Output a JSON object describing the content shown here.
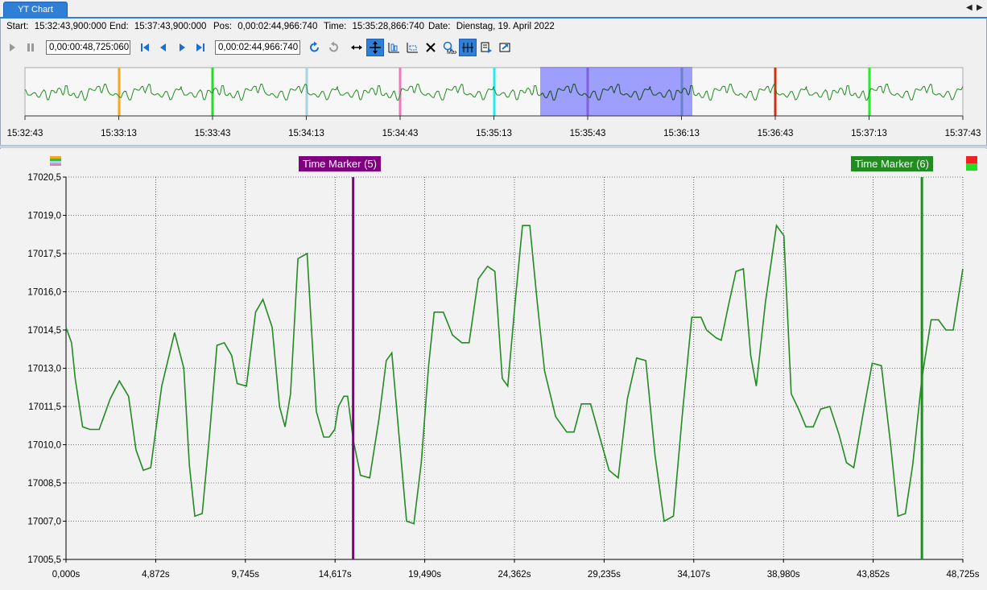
{
  "tab": {
    "title": "YT Chart"
  },
  "info": {
    "start_label": "Start:",
    "start_value": "15:32:43,900:000",
    "end_label": "End:",
    "end_value": "15:37:43,900:000",
    "pos_label": "Pos:",
    "pos_value": "0,00:02:44,966:740",
    "time_label": "Time:",
    "time_value": "15:35:28,866:740",
    "date_label": "Date:",
    "date_value": "Dienstag, 19. April 2022"
  },
  "toolbar": {
    "span_value": "0,00:00:48,725:060",
    "position_value": "0,00:02:44,966:740"
  },
  "overview": {
    "ticks": [
      "15:32:43",
      "15:33:13",
      "15:33:43",
      "15:34:13",
      "15:34:43",
      "15:35:13",
      "15:35:43",
      "15:36:13",
      "15:36:43",
      "15:37:13",
      "15:37:43"
    ],
    "markers": [
      {
        "color": "#f5a623"
      },
      {
        "color": "#22dd22"
      },
      {
        "color": "#a9d2e8"
      },
      {
        "color": "#ee77bb"
      },
      {
        "color": "#22eeee"
      },
      {
        "color": "#800080"
      },
      {
        "color": "#228b22"
      },
      {
        "color": "#cc3311"
      },
      {
        "color": "#22ee22"
      }
    ],
    "selection_color": "#8080ff"
  },
  "chart_data": {
    "type": "line",
    "title": "",
    "xlabel": "",
    "ylabel": "",
    "x_unit": "s",
    "xlim": [
      0,
      48.725
    ],
    "ylim": [
      17005.5,
      17020.5
    ],
    "y_ticks": [
      "17020,5",
      "17019,0",
      "17017,5",
      "17016,0",
      "17014,5",
      "17013,0",
      "17011,5",
      "17010,0",
      "17008,5",
      "17007,0",
      "17005,5"
    ],
    "x_ticks": [
      "0,000s",
      "4,872s",
      "9,745s",
      "14,617s",
      "19,490s",
      "24,362s",
      "29,235s",
      "34,107s",
      "38,980s",
      "43,852s",
      "48,725s"
    ],
    "grid": true,
    "line_color": "#228b22",
    "series": [
      {
        "x": [
          0.0,
          0.3,
          0.5,
          0.9,
          1.3,
          1.8,
          2.4,
          2.9,
          3.4,
          3.8,
          4.2,
          4.6,
          5.2,
          5.9,
          6.4,
          6.7,
          7.0,
          7.4,
          7.8,
          8.2,
          8.6,
          9.0,
          9.3,
          9.8,
          10.3,
          10.7,
          11.2,
          11.6,
          11.9,
          12.2,
          12.6,
          13.1,
          13.6,
          14.0,
          14.3,
          14.6,
          14.8,
          15.1,
          15.3,
          15.6,
          16.0,
          16.5,
          17.0,
          17.4,
          17.7,
          18.1,
          18.5,
          18.9,
          19.3,
          19.7,
          20.0,
          20.5,
          21.0,
          21.5,
          21.9,
          22.4,
          22.9,
          23.3,
          23.7,
          24.0,
          24.4,
          24.8,
          25.2,
          25.6,
          26.0,
          26.6,
          27.2,
          27.6,
          28.0,
          28.5,
          29.0,
          29.5,
          30.0,
          30.5,
          31.0,
          31.5,
          32.0,
          32.5,
          33.0,
          33.5,
          34.0,
          34.5,
          34.8,
          35.3,
          35.6,
          36.0,
          36.4,
          36.8,
          37.2,
          37.5,
          38.0,
          38.6,
          39.0,
          39.4,
          39.8,
          40.2,
          40.6,
          41.0,
          41.5,
          42.0,
          42.4,
          42.8,
          43.3,
          43.8,
          44.3,
          44.8,
          45.2,
          45.6,
          46.0,
          46.5,
          47.0,
          47.4,
          47.8,
          48.2,
          48.725
        ],
        "y": [
          17014.6,
          17014.0,
          17012.6,
          17010.7,
          17010.6,
          17010.6,
          17011.8,
          17012.5,
          17011.9,
          17009.8,
          17009.0,
          17009.1,
          17012.3,
          17014.4,
          17013.0,
          17009.2,
          17007.2,
          17007.3,
          17010.4,
          17013.9,
          17014.0,
          17013.5,
          17012.4,
          17012.3,
          17015.2,
          17015.7,
          17014.6,
          17011.5,
          17010.7,
          17012.0,
          17017.3,
          17017.5,
          17011.3,
          17010.3,
          17010.3,
          17010.6,
          17011.5,
          17011.9,
          17011.9,
          17010.2,
          17008.8,
          17008.7,
          17011.0,
          17013.3,
          17013.6,
          17010.3,
          17007.0,
          17006.9,
          17009.3,
          17013.1,
          17015.2,
          17015.2,
          17014.3,
          17014.0,
          17014.0,
          17016.5,
          17017.0,
          17016.8,
          17012.6,
          17012.3,
          17015.6,
          17018.6,
          17018.6,
          17015.6,
          17012.9,
          17011.1,
          17010.5,
          17010.5,
          17011.6,
          17011.6,
          17010.3,
          17009.0,
          17008.7,
          17011.8,
          17013.4,
          17013.3,
          17009.6,
          17007.0,
          17007.2,
          17011.3,
          17015.0,
          17015.0,
          17014.5,
          17014.2,
          17014.1,
          17015.5,
          17016.8,
          17016.9,
          17013.5,
          17012.3,
          17015.6,
          17018.6,
          17018.2,
          17012.0,
          17011.4,
          17010.7,
          17010.7,
          17011.4,
          17011.5,
          17010.4,
          17009.3,
          17009.1,
          17011.2,
          17013.2,
          17013.1,
          17010.0,
          17007.2,
          17007.3,
          17009.2,
          17012.6,
          17014.9,
          17014.9,
          17014.5,
          17014.5,
          17016.9
        ]
      }
    ]
  },
  "markers_main": {
    "marker5": {
      "label": "Time Marker (5)",
      "color": "#800080",
      "x": 15.6
    },
    "marker6": {
      "label": "Time Marker (6)",
      "color": "#228b22",
      "x": 46.5
    }
  },
  "icons": [
    "play-icon",
    "pause-icon",
    "first-icon",
    "previous-icon",
    "next-icon",
    "last-icon",
    "undo-icon",
    "redo-icon",
    "pan-x-icon",
    "pan-xy-icon",
    "zoom-x-icon",
    "zoom-xy-icon",
    "delete-marker-icon",
    "zoom-max-icon",
    "scale-icon",
    "copy-icon",
    "export-icon",
    "scroll-left-icon",
    "scroll-right-icon"
  ]
}
